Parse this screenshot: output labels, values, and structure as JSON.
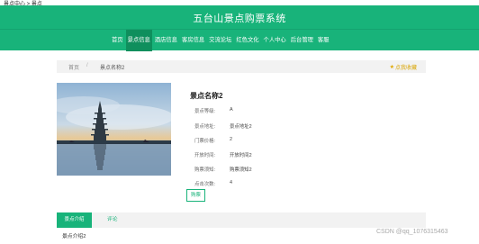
{
  "top_strip": {
    "text": "景点中心 > 景点"
  },
  "site": {
    "title": "五台山景点购票系统"
  },
  "nav": {
    "items": [
      {
        "label": "首页",
        "active": false
      },
      {
        "label": "景点信息",
        "active": true
      },
      {
        "label": "酒店信息",
        "active": false
      },
      {
        "label": "客房信息",
        "active": false
      },
      {
        "label": "交流论坛",
        "active": false
      },
      {
        "label": "红色文化",
        "active": false
      },
      {
        "label": "个人中心",
        "active": false
      },
      {
        "label": "后台管理",
        "active": false
      },
      {
        "label": "客服",
        "active": false
      }
    ]
  },
  "breadcrumb": {
    "home": "首页",
    "separator": "/",
    "current": "景点名称2"
  },
  "favorite": {
    "icon": "star-icon",
    "label": "点我收藏"
  },
  "attraction": {
    "name": "景点名称2",
    "fields": [
      {
        "key": "景点等级:",
        "value": "A"
      },
      {
        "key": "景点地址:",
        "value": "景点地址2"
      },
      {
        "key": "门票价格:",
        "value": "2"
      },
      {
        "key": "开放时间:",
        "value": "开放时间2"
      },
      {
        "key": "购票须知:",
        "value": "购票须知2"
      },
      {
        "key": "点击次数:",
        "value": "4"
      }
    ],
    "buy_label": "购票"
  },
  "tabs": [
    {
      "label": "景点介绍",
      "active": true
    },
    {
      "label": "评论",
      "active": false
    }
  ],
  "intro_text": "景点介绍2",
  "watermark": "CSDN @qq_1076315463",
  "colors": {
    "accent": "#18b37a",
    "nav_active": "#0f8f5d",
    "favorite": "#d9a400"
  }
}
